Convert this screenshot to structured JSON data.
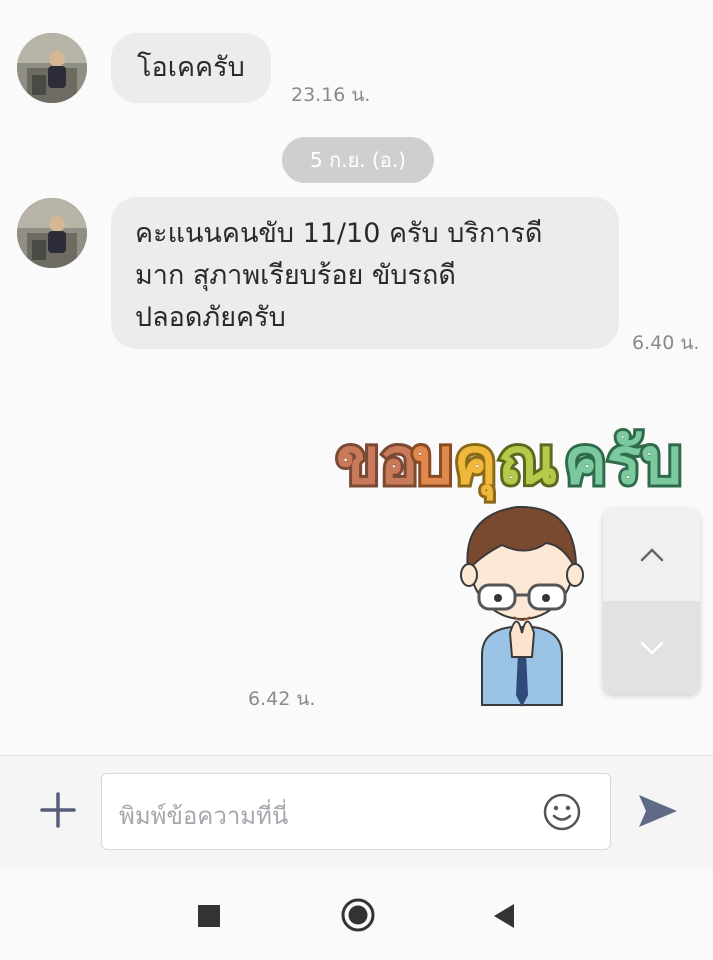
{
  "messages": [
    {
      "sender": "other",
      "text": "โอเคครับ",
      "time": "23.16 น."
    },
    {
      "sender": "other",
      "lines": [
        "คะแนนคนขับ 11/10 ครับ บริการดี",
        "มาก สุภาพเรียบร้อย ขับรถดี",
        "ปลอดภัยครับ"
      ],
      "time": "6.40 น."
    },
    {
      "sender": "other",
      "type": "sticker",
      "sticker_text": "ขอบคุณครับ",
      "time": "6.42 น."
    }
  ],
  "date_separator": "5 ก.ย. (อ.)",
  "composer": {
    "placeholder": "พิมพ์ข้อความที่นี่"
  },
  "icons": {
    "plus": "plus-icon",
    "emoji": "smiley-icon",
    "send": "send-arrow-icon",
    "scroll_up": "chevron-up-icon",
    "scroll_down": "chevron-down-icon",
    "nav_recent": "square-icon",
    "nav_home": "circle-icon",
    "nav_back": "triangle-back-icon"
  },
  "colors": {
    "bubble": "#ececee",
    "sticker_kho_o": "#c97a5a",
    "sticker_bo": "#e0894e",
    "sticker_khu": "#f0b83a",
    "sticker_na": "#8ec26b",
    "sticker_khrap": "#7cc9a0",
    "send_icon": "#5f6a86"
  }
}
